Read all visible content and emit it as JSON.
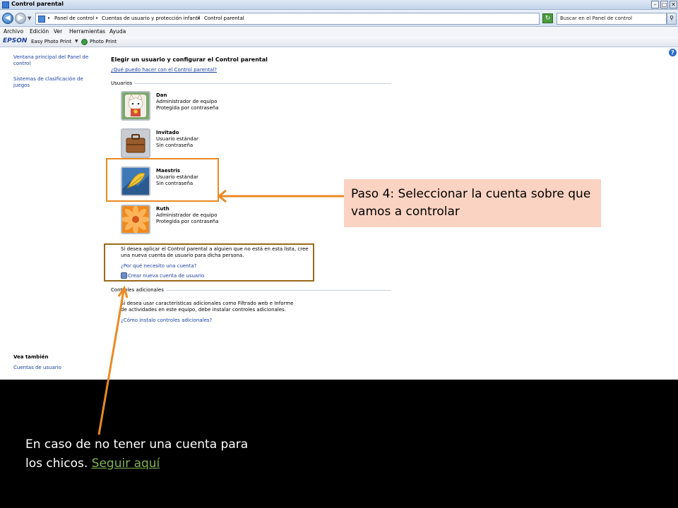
{
  "window": {
    "title": "Control parental",
    "breadcrumbs": [
      "Panel de control",
      "Cuentas de usuario y protección infantil",
      "Control parental"
    ],
    "search_placeholder": "Buscar en el Panel de control",
    "menu": [
      "Archivo",
      "Edición",
      "Ver",
      "Herramientas",
      "Ayuda"
    ],
    "toolbar": {
      "brand": "EPSON",
      "easy_photo_print": "Easy Photo Print",
      "photo_print": "Photo Print"
    },
    "help_glyph": "?"
  },
  "sidebar": {
    "links": [
      "Ventana principal del Panel de control",
      "Sistemas de clasificación de juegos"
    ],
    "see_also_heading": "Vea también",
    "see_also_links": [
      "Cuentas de usuario"
    ]
  },
  "main": {
    "title": "Elegir un usuario y configurar el Control parental",
    "help_link": "¿Qué puedo hacer con el Control parental?",
    "users_section": "Usuarios",
    "users": [
      {
        "name": "Dan",
        "role": "Administrador de equipo",
        "password": "Protegida por contraseña",
        "icon": "cat-icon"
      },
      {
        "name": "Invitado",
        "role": "Usuario estándar",
        "password": "Sin contraseña",
        "icon": "suitcase-icon"
      },
      {
        "name": "Maestris",
        "role": "Usuario estándar",
        "password": "Sin contraseña",
        "icon": "leaf-icon"
      },
      {
        "name": "Ruth",
        "role": "Administrador de equipo",
        "password": "Protegida por contraseña",
        "icon": "flower-icon"
      }
    ],
    "create_text": "Si desea aplicar el Control parental a alguien que no está en esta lista, cree una nueva cuenta de usuario para dicha persona.",
    "why_link": "¿Por qué necesito una cuenta?",
    "create_link": "Crear nueva cuenta de usuario",
    "additional_section": "Controles adicionales",
    "additional_text": "Si desea usar características adicionales como Filtrado web e Informe de actividades en este equipo, debe instalar controles adicionales.",
    "install_link": "¿Cómo instalo controles adicionales?"
  },
  "annotations": {
    "step4": "Paso 4: Seleccionar la cuenta sobre que vamos a controlar",
    "note_prefix": "En caso de no tener una cuenta para los chicos.",
    "note_link": "Seguir aquí",
    "highlight_color": "#e98a23",
    "callout_bg": "#fbd3c2",
    "link_color": "#7fb450"
  }
}
